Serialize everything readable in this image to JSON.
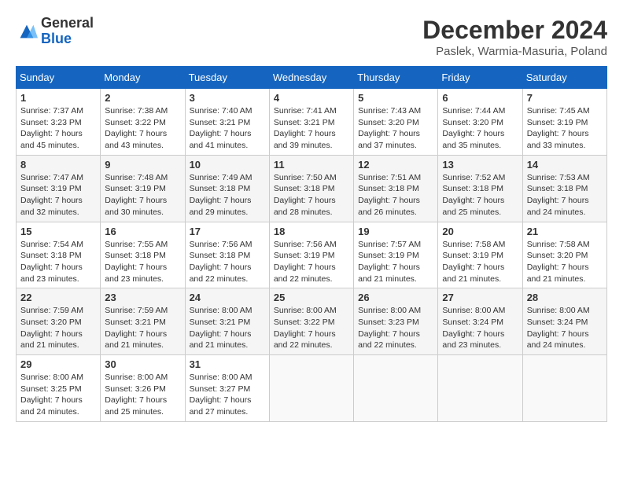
{
  "logo": {
    "general": "General",
    "blue": "Blue"
  },
  "title": "December 2024",
  "subtitle": "Paslek, Warmia-Masuria, Poland",
  "days_header": [
    "Sunday",
    "Monday",
    "Tuesday",
    "Wednesday",
    "Thursday",
    "Friday",
    "Saturday"
  ],
  "weeks": [
    [
      {
        "num": "1",
        "sunrise": "7:37 AM",
        "sunset": "3:23 PM",
        "daylight": "7 hours and 45 minutes."
      },
      {
        "num": "2",
        "sunrise": "7:38 AM",
        "sunset": "3:22 PM",
        "daylight": "7 hours and 43 minutes."
      },
      {
        "num": "3",
        "sunrise": "7:40 AM",
        "sunset": "3:21 PM",
        "daylight": "7 hours and 41 minutes."
      },
      {
        "num": "4",
        "sunrise": "7:41 AM",
        "sunset": "3:21 PM",
        "daylight": "7 hours and 39 minutes."
      },
      {
        "num": "5",
        "sunrise": "7:43 AM",
        "sunset": "3:20 PM",
        "daylight": "7 hours and 37 minutes."
      },
      {
        "num": "6",
        "sunrise": "7:44 AM",
        "sunset": "3:20 PM",
        "daylight": "7 hours and 35 minutes."
      },
      {
        "num": "7",
        "sunrise": "7:45 AM",
        "sunset": "3:19 PM",
        "daylight": "7 hours and 33 minutes."
      }
    ],
    [
      {
        "num": "8",
        "sunrise": "7:47 AM",
        "sunset": "3:19 PM",
        "daylight": "7 hours and 32 minutes."
      },
      {
        "num": "9",
        "sunrise": "7:48 AM",
        "sunset": "3:19 PM",
        "daylight": "7 hours and 30 minutes."
      },
      {
        "num": "10",
        "sunrise": "7:49 AM",
        "sunset": "3:18 PM",
        "daylight": "7 hours and 29 minutes."
      },
      {
        "num": "11",
        "sunrise": "7:50 AM",
        "sunset": "3:18 PM",
        "daylight": "7 hours and 28 minutes."
      },
      {
        "num": "12",
        "sunrise": "7:51 AM",
        "sunset": "3:18 PM",
        "daylight": "7 hours and 26 minutes."
      },
      {
        "num": "13",
        "sunrise": "7:52 AM",
        "sunset": "3:18 PM",
        "daylight": "7 hours and 25 minutes."
      },
      {
        "num": "14",
        "sunrise": "7:53 AM",
        "sunset": "3:18 PM",
        "daylight": "7 hours and 24 minutes."
      }
    ],
    [
      {
        "num": "15",
        "sunrise": "7:54 AM",
        "sunset": "3:18 PM",
        "daylight": "7 hours and 23 minutes."
      },
      {
        "num": "16",
        "sunrise": "7:55 AM",
        "sunset": "3:18 PM",
        "daylight": "7 hours and 23 minutes."
      },
      {
        "num": "17",
        "sunrise": "7:56 AM",
        "sunset": "3:18 PM",
        "daylight": "7 hours and 22 minutes."
      },
      {
        "num": "18",
        "sunrise": "7:56 AM",
        "sunset": "3:19 PM",
        "daylight": "7 hours and 22 minutes."
      },
      {
        "num": "19",
        "sunrise": "7:57 AM",
        "sunset": "3:19 PM",
        "daylight": "7 hours and 21 minutes."
      },
      {
        "num": "20",
        "sunrise": "7:58 AM",
        "sunset": "3:19 PM",
        "daylight": "7 hours and 21 minutes."
      },
      {
        "num": "21",
        "sunrise": "7:58 AM",
        "sunset": "3:20 PM",
        "daylight": "7 hours and 21 minutes."
      }
    ],
    [
      {
        "num": "22",
        "sunrise": "7:59 AM",
        "sunset": "3:20 PM",
        "daylight": "7 hours and 21 minutes."
      },
      {
        "num": "23",
        "sunrise": "7:59 AM",
        "sunset": "3:21 PM",
        "daylight": "7 hours and 21 minutes."
      },
      {
        "num": "24",
        "sunrise": "8:00 AM",
        "sunset": "3:21 PM",
        "daylight": "7 hours and 21 minutes."
      },
      {
        "num": "25",
        "sunrise": "8:00 AM",
        "sunset": "3:22 PM",
        "daylight": "7 hours and 22 minutes."
      },
      {
        "num": "26",
        "sunrise": "8:00 AM",
        "sunset": "3:23 PM",
        "daylight": "7 hours and 22 minutes."
      },
      {
        "num": "27",
        "sunrise": "8:00 AM",
        "sunset": "3:24 PM",
        "daylight": "7 hours and 23 minutes."
      },
      {
        "num": "28",
        "sunrise": "8:00 AM",
        "sunset": "3:24 PM",
        "daylight": "7 hours and 24 minutes."
      }
    ],
    [
      {
        "num": "29",
        "sunrise": "8:00 AM",
        "sunset": "3:25 PM",
        "daylight": "7 hours and 24 minutes."
      },
      {
        "num": "30",
        "sunrise": "8:00 AM",
        "sunset": "3:26 PM",
        "daylight": "7 hours and 25 minutes."
      },
      {
        "num": "31",
        "sunrise": "8:00 AM",
        "sunset": "3:27 PM",
        "daylight": "7 hours and 27 minutes."
      },
      null,
      null,
      null,
      null
    ]
  ]
}
